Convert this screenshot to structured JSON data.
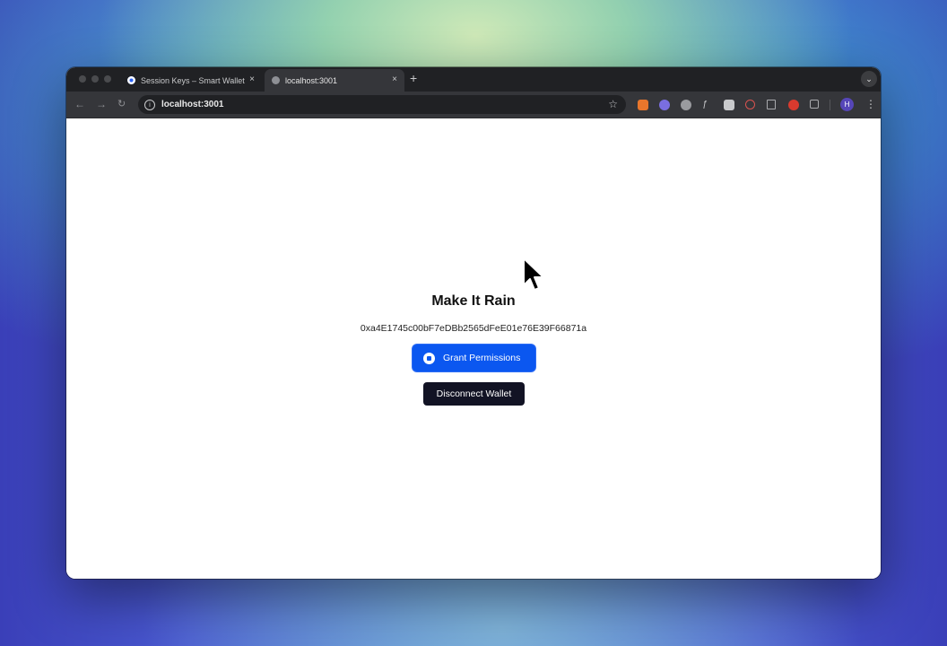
{
  "browser": {
    "tabs": [
      {
        "title": "Session Keys – Smart Wallet",
        "active": false
      },
      {
        "title": "localhost:3001",
        "active": true
      }
    ],
    "new_tab_icon": "+",
    "close_icon": "×",
    "tab_menu_icon": "⌄",
    "address_url": "localhost:3001",
    "profile_initial": "H"
  },
  "page": {
    "heading": "Make It Rain",
    "wallet_address": "0xa4E1745c00bF7eDBb2565dFeE01e76E39F66871a",
    "grant_button_label": "Grant Permissions",
    "disconnect_button_label": "Disconnect Wallet"
  },
  "colors": {
    "grant_button": "#0b57f0",
    "disconnect_button": "#121324",
    "browser_chrome": "#202124"
  }
}
